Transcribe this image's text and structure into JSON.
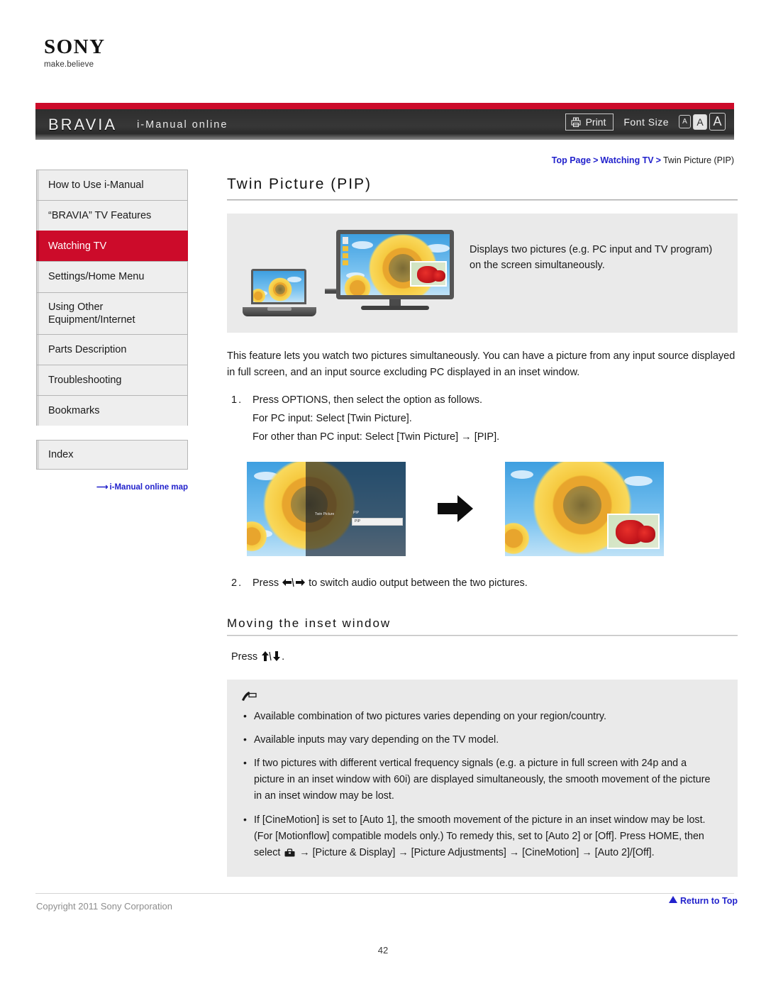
{
  "brand": {
    "logo_text": "SONY",
    "tagline": "make.believe"
  },
  "header": {
    "product": "BRAVIA",
    "title": "i-Manual online",
    "print_label": "Print",
    "font_size_label": "Font Size",
    "font_sizes": [
      {
        "label": "A",
        "selected": false
      },
      {
        "label": "A",
        "selected": true
      },
      {
        "label": "A",
        "selected": false
      }
    ],
    "accent_red": "#cc0b2a",
    "bar_dark": "#333333"
  },
  "breadcrumb": {
    "items": [
      "Top Page",
      "Watching TV",
      "Twin Picture (PIP)"
    ],
    "separator": ">",
    "link_color": "#2222cc"
  },
  "sidebar": {
    "items": [
      {
        "label": "How to Use i-Manual",
        "active": false
      },
      {
        "label": "“BRAVIA” TV Features",
        "active": false
      },
      {
        "label": "Watching TV",
        "active": true
      },
      {
        "label": "Settings/Home Menu",
        "active": false
      },
      {
        "label": "Using Other Equipment/Internet",
        "active": false
      },
      {
        "label": "Parts Description",
        "active": false
      },
      {
        "label": "Troubleshooting",
        "active": false
      },
      {
        "label": "Bookmarks",
        "active": false
      }
    ],
    "index_label": "Index",
    "map_link": "i-Manual online map"
  },
  "main": {
    "page_title": "Twin Picture (PIP)",
    "summary": "Displays two pictures (e.g. PC input and TV program) on the screen simultaneously.",
    "intro": "This feature lets you watch two pictures simultaneously. You can have a picture from any input source displayed in full screen, and an input source excluding PC displayed in an inset window.",
    "steps": [
      {
        "number": "1.",
        "text": "Press OPTIONS, then select the option as follows.",
        "sub": [
          "For PC input: Select [Twin Picture].",
          "For other than PC input: Select [Twin Picture] → [PIP]."
        ]
      },
      {
        "number": "2.",
        "text_before_icon": "Press ",
        "text_after_icon": " to switch audio output between the two pictures.",
        "icon": "left-right-arrow-keys"
      }
    ],
    "figure_osd": {
      "menu_item": "Twin Picture",
      "field_title": "PIP",
      "field_value": "PIP"
    },
    "section_title": "Moving the inset window",
    "press_before": "Press ",
    "press_after": ".",
    "press_icon": "up-down-arrow-keys"
  },
  "notes": {
    "icon": "note-pencil-icon",
    "items": [
      "Available combination of two pictures varies depending on your region/country.",
      "Available inputs may vary depending on the TV model.",
      "If two pictures with different vertical frequency signals (e.g. a picture in full screen with 24p and a picture in an inset window with 60i) are displayed simultaneously, the smooth movement of the picture in an inset window may be lost."
    ],
    "cinemotion_note": {
      "part1": "If [CineMotion] is set to [Auto 1], the smooth movement of the picture in an inset window may be lost. (For [Motionflow] compatible models only.) To remedy this, set to [Auto 2] or [Off]. Press HOME, then select ",
      "icon": "toolbox-icon",
      "part2": " → [Picture & Display] → [Picture Adjustments] → [CineMotion] → [Auto 2]/[Off]."
    }
  },
  "footer": {
    "return_to_top": "Return to Top",
    "copyright": "Copyright 2011 Sony Corporation",
    "page_number": "42"
  }
}
